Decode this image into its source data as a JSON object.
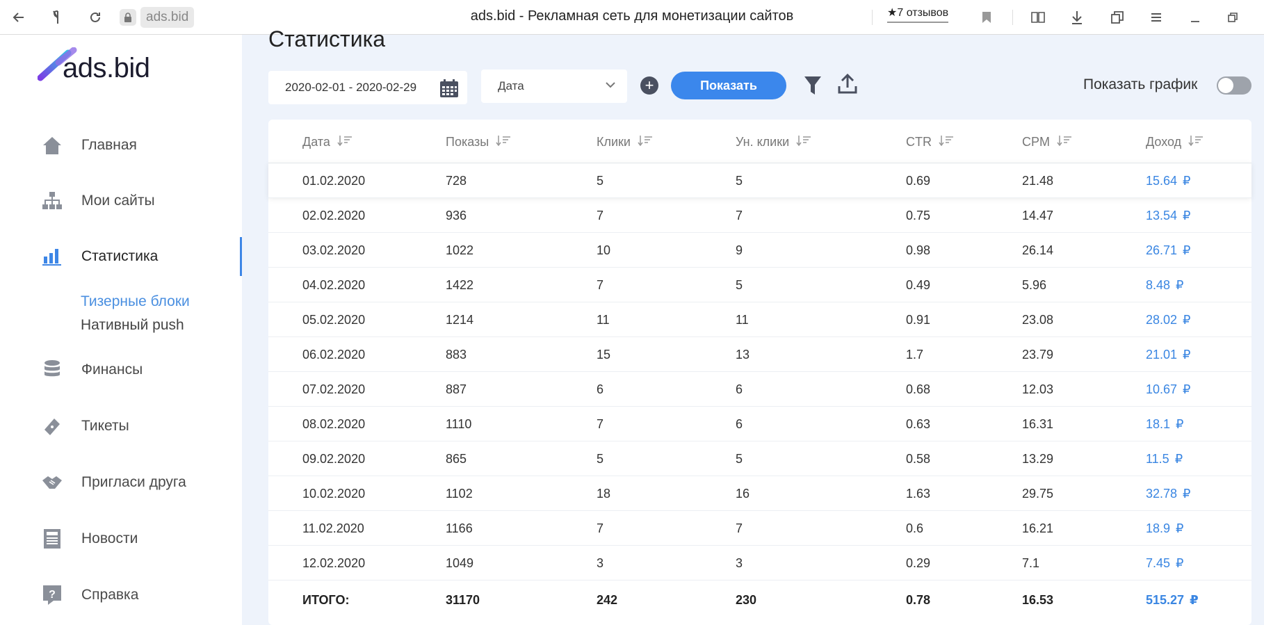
{
  "browser": {
    "domain": "ads.bid",
    "page_title": "ads.bid - Рекламная сеть для монетизации сайтов",
    "reviews": "★7 отзывов"
  },
  "logo": {
    "text": "ads.bid"
  },
  "sidebar": {
    "items": [
      {
        "label": "Главная",
        "icon": "home-icon"
      },
      {
        "label": "Мои сайты",
        "icon": "sitemap-icon"
      },
      {
        "label": "Статистика",
        "icon": "bar-chart-icon",
        "active": true
      },
      {
        "label": "Финансы",
        "icon": "database-icon"
      },
      {
        "label": "Тикеты",
        "icon": "ticket-icon"
      },
      {
        "label": "Пригласи друга",
        "icon": "handshake-icon"
      },
      {
        "label": "Новости",
        "icon": "newspaper-icon"
      },
      {
        "label": "Справка",
        "icon": "question-icon"
      }
    ],
    "subitems": [
      {
        "label": "Тизерные блоки",
        "active": true,
        "color": "#4a8fe0"
      },
      {
        "label": "Нативный push",
        "active": false,
        "color": "#444444"
      }
    ]
  },
  "main": {
    "title": "Статистика",
    "date_range": "2020-02-01 - 2020-02-29",
    "group_select": "Дата",
    "show_button": "Показать",
    "show_graph_label": "Показать график",
    "show_graph_on": false
  },
  "table": {
    "headers": [
      "Дата",
      "Показы",
      "Клики",
      "Ун. клики",
      "CTR",
      "CPM",
      "Доход"
    ],
    "rows": [
      [
        "01.02.2020",
        "728",
        "5",
        "5",
        "0.69",
        "21.48",
        "15.64"
      ],
      [
        "02.02.2020",
        "936",
        "7",
        "7",
        "0.75",
        "14.47",
        "13.54"
      ],
      [
        "03.02.2020",
        "1022",
        "10",
        "9",
        "0.98",
        "26.14",
        "26.71"
      ],
      [
        "04.02.2020",
        "1422",
        "7",
        "5",
        "0.49",
        "5.96",
        "8.48"
      ],
      [
        "05.02.2020",
        "1214",
        "11",
        "11",
        "0.91",
        "23.08",
        "28.02"
      ],
      [
        "06.02.2020",
        "883",
        "15",
        "13",
        "1.7",
        "23.79",
        "21.01"
      ],
      [
        "07.02.2020",
        "887",
        "6",
        "6",
        "0.68",
        "12.03",
        "10.67"
      ],
      [
        "08.02.2020",
        "1110",
        "7",
        "6",
        "0.63",
        "16.31",
        "18.1"
      ],
      [
        "09.02.2020",
        "865",
        "5",
        "5",
        "0.58",
        "13.29",
        "11.5"
      ],
      [
        "10.02.2020",
        "1102",
        "18",
        "16",
        "1.63",
        "29.75",
        "32.78"
      ],
      [
        "11.02.2020",
        "1166",
        "7",
        "7",
        "0.6",
        "16.21",
        "18.9"
      ],
      [
        "12.02.2020",
        "1049",
        "3",
        "3",
        "0.29",
        "7.1",
        "7.45"
      ]
    ],
    "total": [
      "ИТОГО:",
      "31170",
      "242",
      "230",
      "0.78",
      "16.53",
      "515.27"
    ],
    "currency": "₽",
    "accent_color": "#3a86e2"
  }
}
